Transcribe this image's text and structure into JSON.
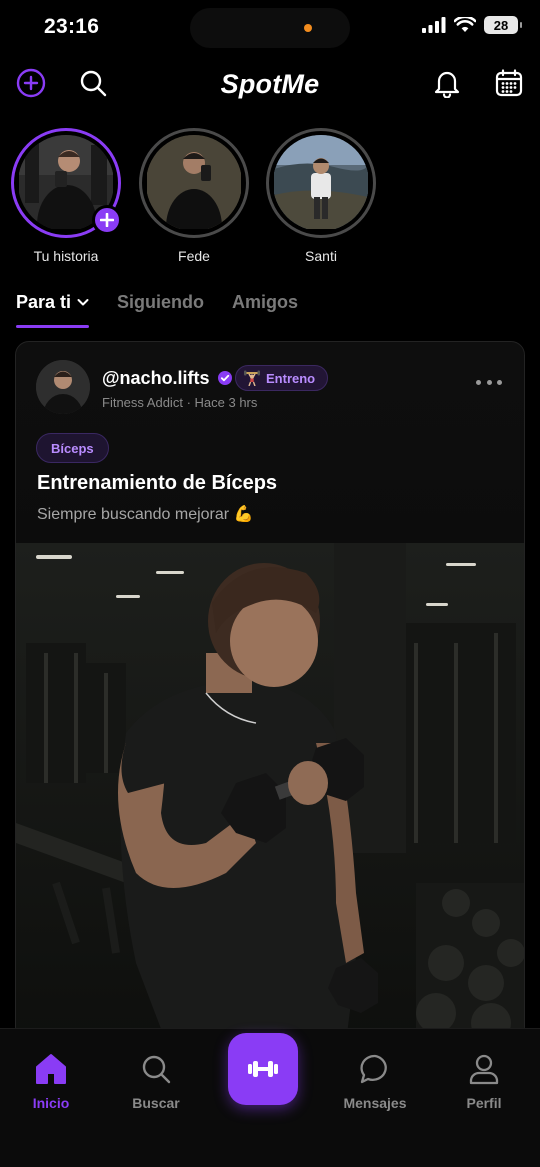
{
  "status_bar": {
    "time": "23:16",
    "battery": "28"
  },
  "header": {
    "title": "SpotMe"
  },
  "stories": [
    {
      "label": "Tu historia",
      "own": true
    },
    {
      "label": "Fede",
      "own": false
    },
    {
      "label": "Santi",
      "own": false
    }
  ],
  "tabs": [
    {
      "label": "Para ti",
      "active": true
    },
    {
      "label": "Siguiendo",
      "active": false
    },
    {
      "label": "Amigos",
      "active": false
    }
  ],
  "post": {
    "username": "@nacho.lifts",
    "badge": "Entreno",
    "subtitle": "Fitness Addict",
    "time": "Hace 3 hrs",
    "tag": "Bíceps",
    "title": "Entrenamiento de Bíceps",
    "description": "Siempre buscando mejorar 💪"
  },
  "nav": {
    "home": "Inicio",
    "search": "Buscar",
    "messages": "Mensajes",
    "profile": "Perfil"
  },
  "colors": {
    "accent": "#8a3cf5",
    "background": "#000000",
    "muted": "#8a8a8a"
  }
}
